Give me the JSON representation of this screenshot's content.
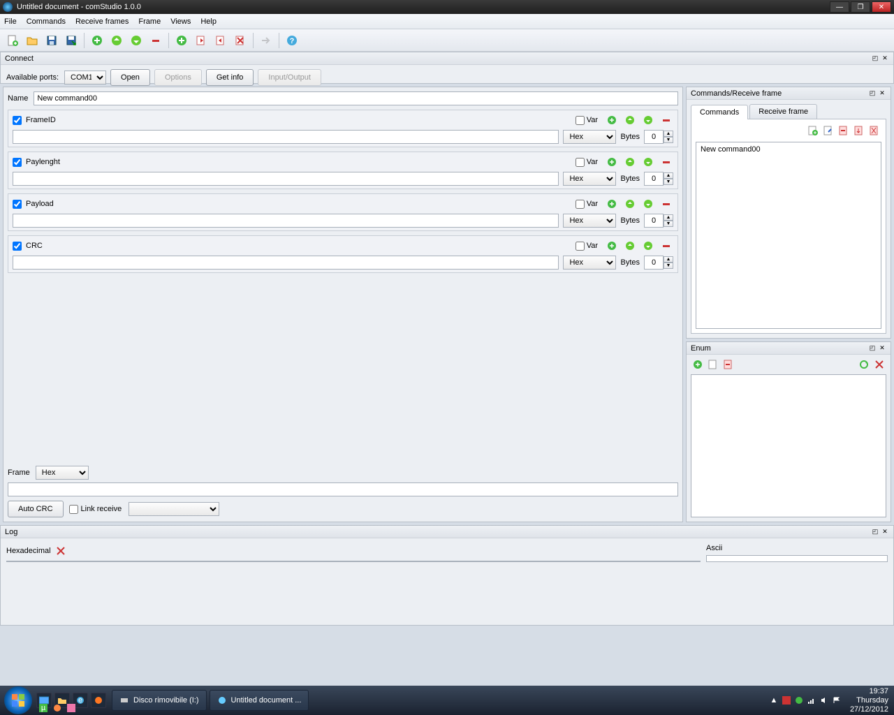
{
  "window": {
    "title": "Untitled document - comStudio 1.0.0"
  },
  "menu": {
    "file": "File",
    "commands": "Commands",
    "receive_frames": "Receive frames",
    "frame": "Frame",
    "views": "Views",
    "help": "Help"
  },
  "connect": {
    "title": "Connect",
    "ports_label": "Available ports:",
    "port_selected": "COM1",
    "open": "Open",
    "options": "Options",
    "get_info": "Get info",
    "io": "Input/Output"
  },
  "editor": {
    "name_label": "Name",
    "name_value": "New command00",
    "var_label": "Var",
    "bytes_label": "Bytes",
    "format_selected": "Hex",
    "bytes_value": "0",
    "fields": [
      {
        "label": "FrameID",
        "checked": true
      },
      {
        "label": "Paylenght",
        "checked": true
      },
      {
        "label": "Payload",
        "checked": true
      },
      {
        "label": "CRC",
        "checked": true
      }
    ],
    "frame_label": "Frame",
    "frame_format": "Hex",
    "auto_crc": "Auto CRC",
    "link_receive": "Link receive"
  },
  "commands_panel": {
    "title": "Commands/Receive frame",
    "tab_commands": "Commands",
    "tab_receive": "Receive frame",
    "items": [
      "New command00"
    ]
  },
  "enum_panel": {
    "title": "Enum"
  },
  "log_panel": {
    "title": "Log",
    "hex_label": "Hexadecimal",
    "ascii_label": "Ascii"
  },
  "taskbar": {
    "btn1": "Disco rimovibile (I:)",
    "btn2": "Untitled document ...",
    "time": "19:37",
    "day": "Thursday",
    "date": "27/12/2012"
  }
}
